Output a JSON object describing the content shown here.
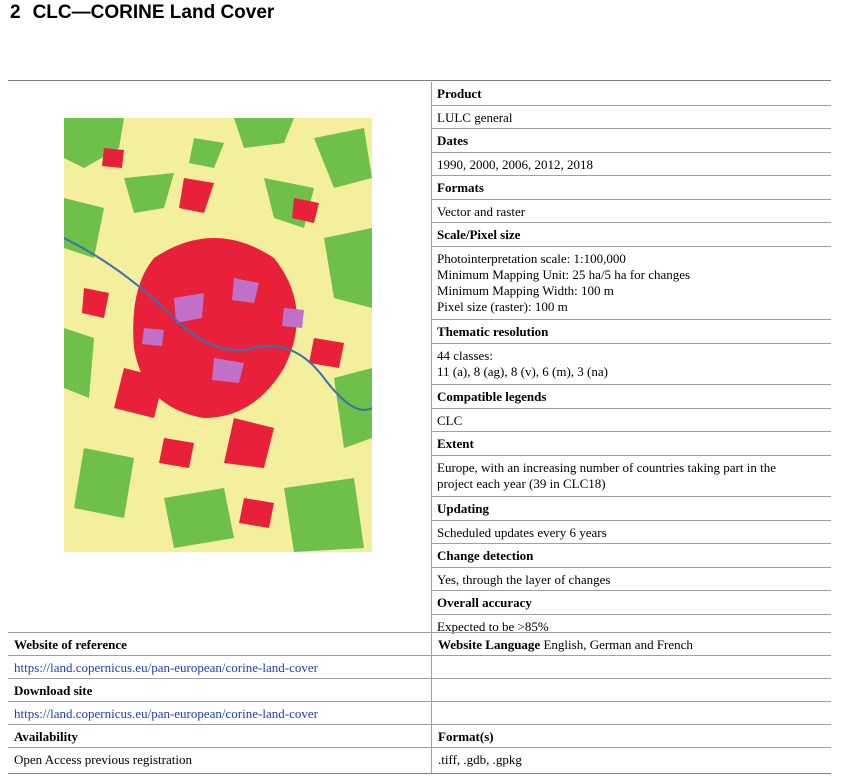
{
  "heading": {
    "number": "2",
    "title": "CLC—CORINE Land Cover"
  },
  "attributes": [
    {
      "label": "Product",
      "value": "LULC general"
    },
    {
      "label": "Dates",
      "value": "1990, 2000, 2006, 2012, 2018"
    },
    {
      "label": "Formats",
      "value": "Vector and raster"
    },
    {
      "label": "Scale/Pixel size",
      "value_lines": [
        "Photointerpretation scale: 1:100,000",
        "Minimum Mapping Unit: 25 ha/5 ha for changes",
        "Minimum Mapping Width: 100 m",
        "Pixel size (raster): 100 m"
      ]
    },
    {
      "label": "Thematic resolution",
      "value_lines": [
        "44 classes:",
        "11 (a), 8 (ag), 8 (v), 6 (m), 3 (na)"
      ]
    },
    {
      "label": "Compatible legends",
      "value": "CLC"
    },
    {
      "label": "Extent",
      "value_lines": [
        "Europe, with an increasing number of countries taking part in the",
        "project each year (39 in CLC18)"
      ]
    },
    {
      "label": "Updating",
      "value": "Scheduled updates every 6 years"
    },
    {
      "label": "Change detection",
      "value": "Yes, through the layer of changes"
    },
    {
      "label": "Overall accuracy",
      "value": "Expected to be >85%"
    }
  ],
  "website_reference": {
    "label": "Website of reference",
    "url": "https://land.copernicus.eu/pan-european/corine-land-cover"
  },
  "website_language": {
    "label": "Website Language",
    "value": "English, German and French"
  },
  "download_site": {
    "label": "Download site",
    "url": "https://land.copernicus.eu/pan-european/corine-land-cover"
  },
  "availability": {
    "label": "Availability",
    "value": "Open Access previous registration"
  },
  "formats_download": {
    "label": "Format(s)",
    "value": ".tiff, .gdb, .gpkg"
  },
  "colors": {
    "link": "#1a3fbf",
    "urban": "#e8203a",
    "forest": "#6fc04a",
    "agri": "#f3ef9c",
    "industrial": "#c070c8"
  }
}
